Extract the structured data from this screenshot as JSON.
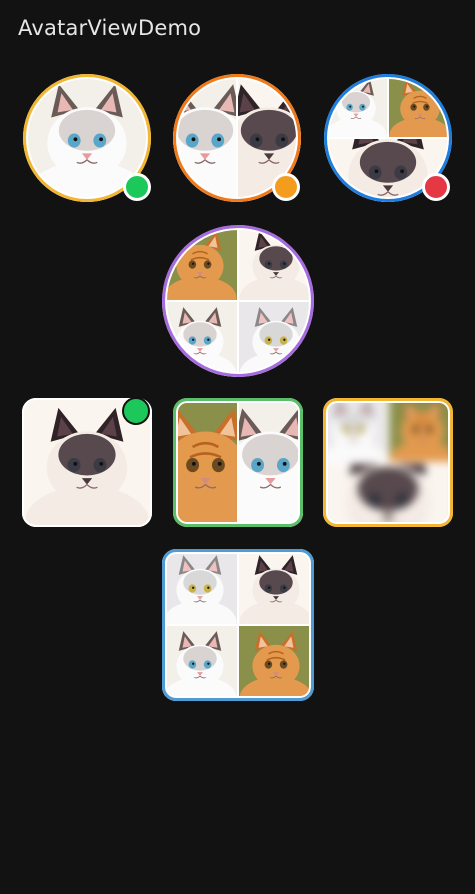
{
  "app": {
    "title": "AvatarViewDemo"
  },
  "colors": {
    "background": "#121212",
    "ring_yellow": "#F2B632",
    "ring_orange": "#F07A1A",
    "ring_blue": "#1E7EE0",
    "ring_purple": "#A66BE0",
    "ring_green": "#5BBF6A",
    "ring_light_blue": "#4F9BD6",
    "status_online": "#1DC85A",
    "status_away": "#F39C1E",
    "status_busy": "#E63744"
  },
  "avatars": [
    {
      "shape": "circle",
      "ring": "yellow",
      "images": [
        "ragdoll-white-cat"
      ],
      "status": "online"
    },
    {
      "shape": "circle",
      "ring": "orange",
      "images": [
        "ragdoll-white-cat",
        "siamese-fluffy-cat"
      ],
      "status": "away"
    },
    {
      "shape": "circle",
      "ring": "blue",
      "images": [
        "ragdoll-white-cat",
        "orange-tabby-cat",
        "siamese-fluffy-cat"
      ],
      "status": "busy"
    },
    {
      "shape": "circle",
      "ring": "purple",
      "images": [
        "orange-tabby-cat",
        "siamese-fluffy-cat",
        "ragdoll-white-cat",
        "gray-white-cat"
      ],
      "status": null
    },
    {
      "shape": "rounded",
      "ring": null,
      "images": [
        "siamese-fluffy-cat"
      ],
      "status": "online"
    },
    {
      "shape": "rounded",
      "ring": "green",
      "images": [
        "orange-tabby-cat",
        "ragdoll-white-cat"
      ],
      "status": null
    },
    {
      "shape": "rounded",
      "ring": "yellow",
      "images": [
        "gray-white-cat",
        "orange-tabby-cat",
        "siamese-fluffy-cat"
      ],
      "status": null,
      "blurred": true
    },
    {
      "shape": "rounded",
      "ring": "light_blue",
      "images": [
        "gray-white-cat",
        "siamese-fluffy-cat",
        "ragdoll-white-cat",
        "orange-tabby-cat"
      ],
      "status": null
    }
  ]
}
